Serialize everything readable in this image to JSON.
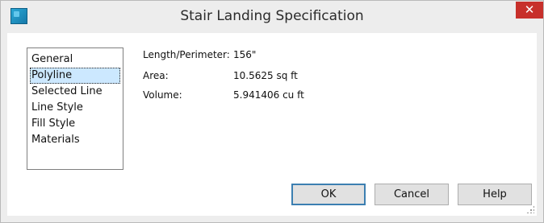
{
  "window": {
    "title": "Stair Landing Specification",
    "close_glyph": "✕"
  },
  "nav": {
    "items": [
      {
        "label": "General",
        "selected": false
      },
      {
        "label": "Polyline",
        "selected": true
      },
      {
        "label": "Selected Line",
        "selected": false
      },
      {
        "label": "Line Style",
        "selected": false
      },
      {
        "label": "Fill Style",
        "selected": false
      },
      {
        "label": "Materials",
        "selected": false
      }
    ]
  },
  "properties": [
    {
      "label": "Length/Perimeter:",
      "value": "156\""
    },
    {
      "label": "Area:",
      "value": "10.5625 sq ft"
    },
    {
      "label": "Volume:",
      "value": "5.941406 cu ft"
    }
  ],
  "buttons": {
    "ok": "OK",
    "cancel": "Cancel",
    "help": "Help"
  },
  "colors": {
    "accent_close": "#c7302b",
    "selection": "#cce8ff"
  },
  "icons": {
    "app": "app-icon",
    "close": "close-icon",
    "resize": "resize-grip-icon"
  }
}
